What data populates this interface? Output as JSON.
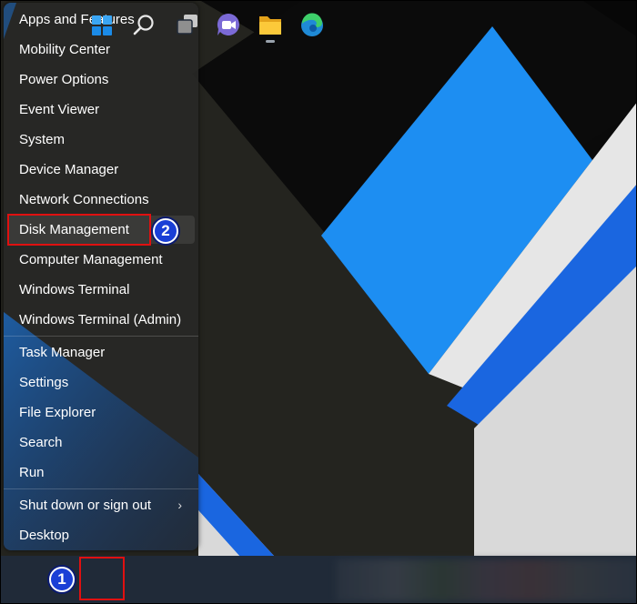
{
  "menu": {
    "items": [
      {
        "label": "Apps and Features"
      },
      {
        "label": "Mobility Center"
      },
      {
        "label": "Power Options"
      },
      {
        "label": "Event Viewer"
      },
      {
        "label": "System"
      },
      {
        "label": "Device Manager"
      },
      {
        "label": "Network Connections"
      },
      {
        "label": "Disk Management"
      },
      {
        "label": "Computer Management"
      },
      {
        "label": "Windows Terminal"
      },
      {
        "label": "Windows Terminal (Admin)"
      },
      {
        "label": "Task Manager"
      },
      {
        "label": "Settings"
      },
      {
        "label": "File Explorer"
      },
      {
        "label": "Search"
      },
      {
        "label": "Run"
      },
      {
        "label": "Shut down or sign out"
      },
      {
        "label": "Desktop"
      }
    ]
  },
  "annotations": {
    "step1": "1",
    "step2": "2"
  },
  "taskbar": {
    "icons": [
      "windows-start-icon",
      "search-icon",
      "task-view-icon",
      "teams-chat-icon",
      "file-explorer-icon",
      "edge-browser-icon"
    ]
  },
  "colors": {
    "highlight": "#e01010",
    "badge": "#1a3fd6",
    "accent_blue": "#1e8cf0"
  }
}
